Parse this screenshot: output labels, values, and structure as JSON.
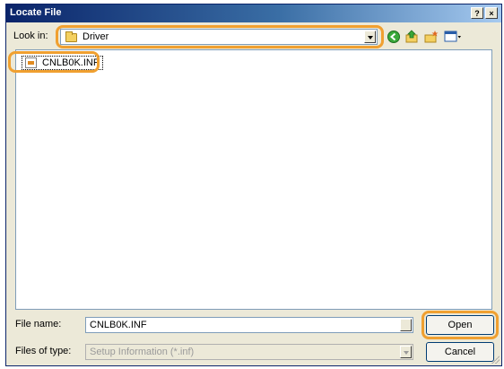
{
  "window": {
    "title": "Locate File",
    "help_label": "?",
    "close_label": "×"
  },
  "toolbar": {
    "look_in_label": "Look in:",
    "look_in_value": "Driver",
    "icons": [
      "back-icon",
      "up-folder-icon",
      "new-folder-icon",
      "view-menu-icon"
    ]
  },
  "files": [
    {
      "name": "CNLB0K.INF",
      "icon": "inf-file-icon"
    }
  ],
  "footer": {
    "file_name_label": "File name:",
    "file_name_value": "CNLB0K.INF",
    "file_type_label": "Files of type:",
    "file_type_value": "Setup Information (*.inf)",
    "open_label": "Open",
    "cancel_label": "Cancel"
  },
  "colors": {
    "highlight": "#f0a030",
    "title_bar": "#0a246a",
    "dialog_bg": "#ece9d8"
  }
}
